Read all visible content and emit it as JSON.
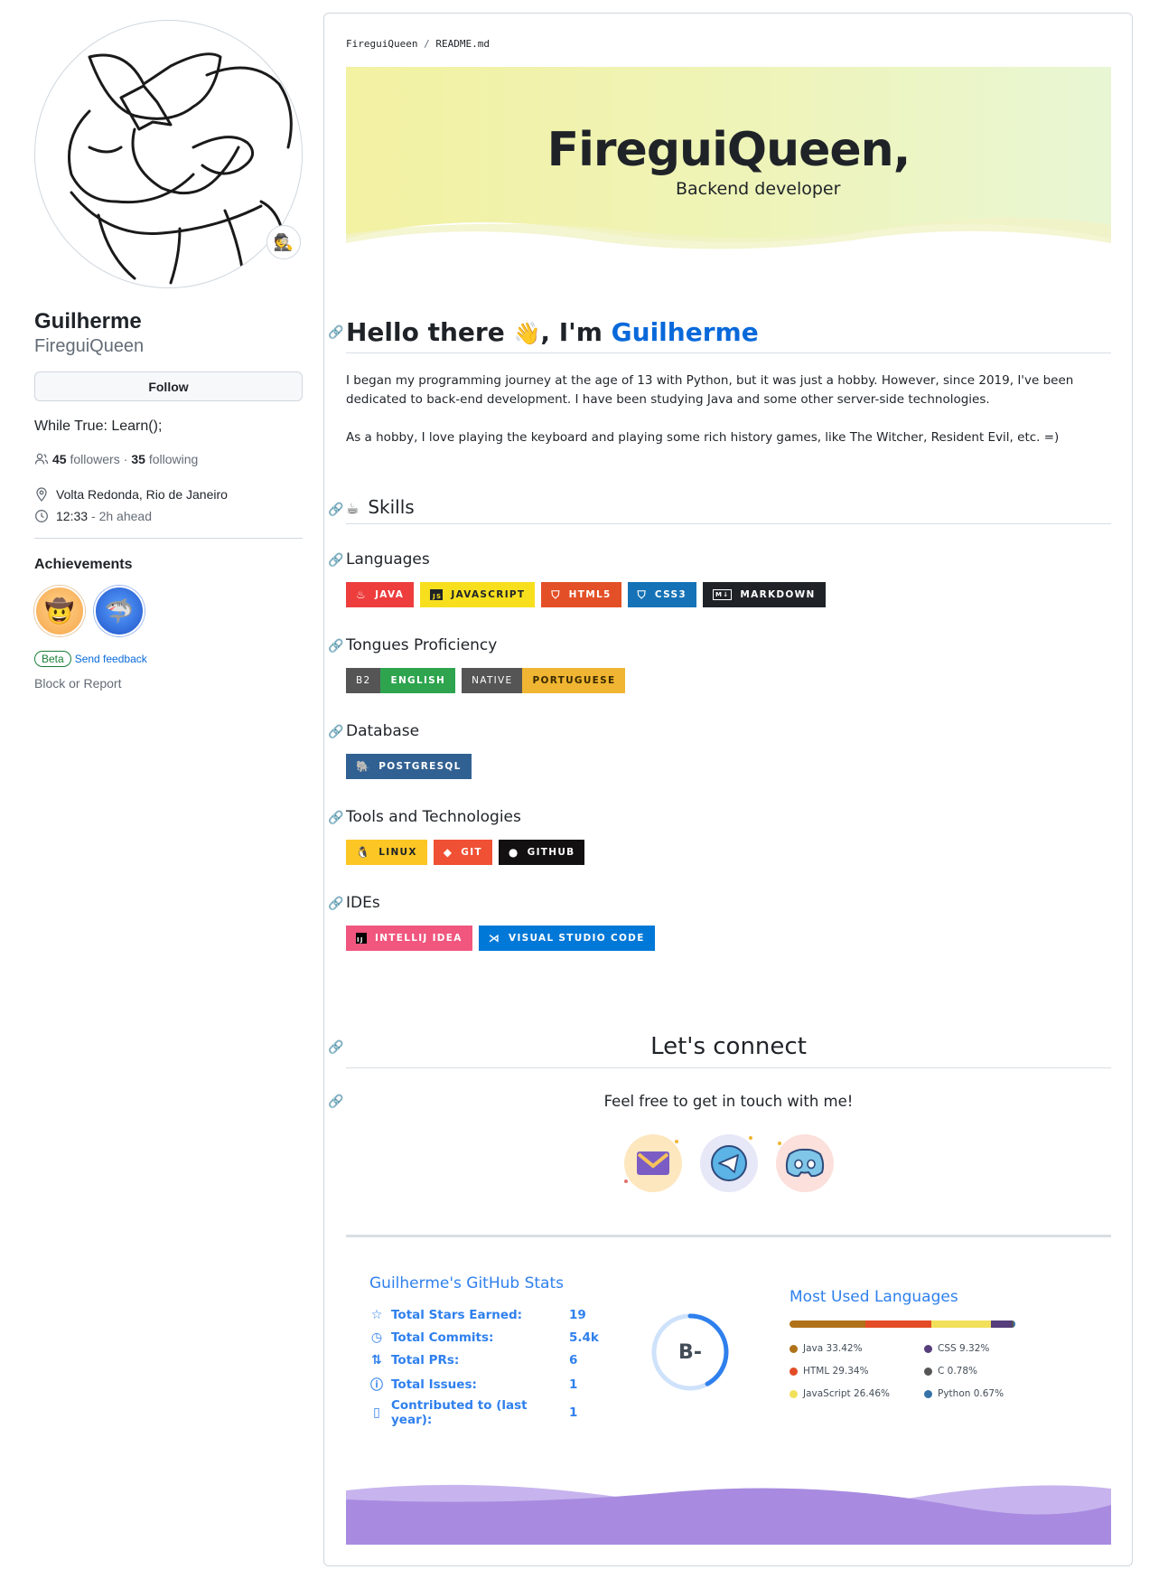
{
  "profile": {
    "name": "Guilherme",
    "login": "FireguiQueen",
    "follow_label": "Follow",
    "bio": "While True: Learn();",
    "followers_count": "45",
    "followers_label": "followers",
    "following_count": "35",
    "following_label": "following",
    "separator": "·",
    "location": "Volta Redonda, Rio de Janeiro",
    "time": "12:33",
    "time_offset": "- 2h ahead",
    "achievements_title": "Achievements",
    "beta_label": "Beta",
    "send_feedback": "Send feedback",
    "block_report": "Block or Report",
    "status_icon": "detective-emoji-icon"
  },
  "readme": {
    "breadcrumb_user": "FireguiQueen",
    "breadcrumb_sep": "/",
    "breadcrumb_file": "README.md",
    "banner_title": "FireguiQueen,",
    "banner_subtitle": "Backend developer",
    "hello_prefix": "Hello there",
    "hello_emoji": "👋",
    "hello_mid": ", I'm",
    "hello_name": "Guilherme",
    "intro_1": "I began my programming journey at the age of 13 with Python, but it was just a hobby. However, since 2019, I've been dedicated to back-end development. I have been studying Java and some other server-side technologies.",
    "intro_2": "As a hobby, I love playing the keyboard and playing some rich history games, like The Witcher, Resident Evil, etc. =)",
    "skills_title": "Skills",
    "languages_title": "Languages",
    "languages": [
      "JAVA",
      "JAVASCRIPT",
      "HTML5",
      "CSS3",
      "MARKDOWN"
    ],
    "tongues_title": "Tongues Proficiency",
    "tongues": [
      {
        "level": "B2",
        "lang": "ENGLISH"
      },
      {
        "level": "NATIVE",
        "lang": "PORTUGUESE"
      }
    ],
    "database_title": "Database",
    "databases": [
      "POSTGRESQL"
    ],
    "tools_title": "Tools and Technologies",
    "tools": [
      "LINUX",
      "GIT",
      "GITHUB"
    ],
    "ides_title": "IDEs",
    "ides": [
      "INTELLIJ IDEA",
      "VISUAL STUDIO CODE"
    ],
    "connect_title": "Let's connect",
    "connect_subtitle": "Feel free to get in touch with me!",
    "socials": [
      "mail-icon",
      "telegram-icon",
      "discord-icon"
    ]
  },
  "stats": {
    "title": "Guilherme's GitHub Stats",
    "rows": [
      {
        "icon": "star-icon",
        "label": "Total Stars Earned:",
        "value": "19"
      },
      {
        "icon": "history-icon",
        "label": "Total Commits:",
        "value": "5.4k"
      },
      {
        "icon": "pull-request-icon",
        "label": "Total PRs:",
        "value": "6"
      },
      {
        "icon": "issue-icon",
        "label": "Total Issues:",
        "value": "1"
      },
      {
        "icon": "repo-icon",
        "label": "Contributed to (last year):",
        "value": "1"
      }
    ],
    "rank": "B-",
    "rank_progress": 0.42
  },
  "languages_card": {
    "title": "Most Used Languages",
    "items": [
      {
        "name": "Java",
        "percent": "33.42%",
        "value": 33.42,
        "color": "#b07219"
      },
      {
        "name": "HTML",
        "percent": "29.34%",
        "value": 29.34,
        "color": "#e34c26"
      },
      {
        "name": "JavaScript",
        "percent": "26.46%",
        "value": 26.46,
        "color": "#f1e05a"
      },
      {
        "name": "CSS",
        "percent": "9.32%",
        "value": 9.32,
        "color": "#563d7c"
      },
      {
        "name": "C",
        "percent": "0.78%",
        "value": 0.78,
        "color": "#555555"
      },
      {
        "name": "Python",
        "percent": "0.67%",
        "value": 0.67,
        "color": "#3572A5"
      }
    ]
  },
  "colors": {
    "link": "#0969da",
    "stats_accent": "#2f80ed",
    "wave_purple": "#a88be0"
  }
}
